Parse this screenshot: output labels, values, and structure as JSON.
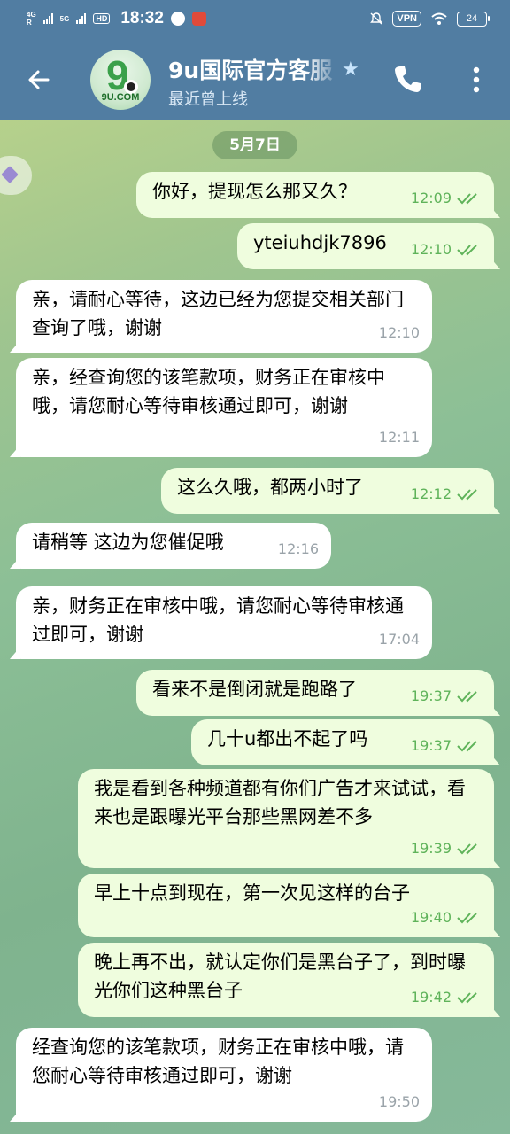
{
  "status_bar": {
    "net1": "4G",
    "net1_sub": "R",
    "net2": "5G",
    "hd": "HD",
    "time": "18:32",
    "vpn": "VPN",
    "battery": "24"
  },
  "header": {
    "title": "9u国际官方客服",
    "subtitle": "最近曾上线",
    "avatar_text": "9U.COM",
    "avatar_digit": "9"
  },
  "chat": {
    "date": "5月7日",
    "messages": [
      {
        "dir": "out",
        "text": "你好，提现怎么那又久？",
        "time": "12:09"
      },
      {
        "dir": "out",
        "text": "yteiuhdjk7896",
        "time": "12:10"
      },
      {
        "dir": "in",
        "text": "亲，请耐心等待，这边已经为您提交相关部门查询了哦，谢谢",
        "time": "12:10"
      },
      {
        "dir": "in",
        "text": "亲，经查询您的该笔款项，财务正在审核中哦，请您耐心等待审核通过即可，谢谢",
        "time": "12:11"
      },
      {
        "dir": "out",
        "text": "这么久哦，都两小时了",
        "time": "12:12"
      },
      {
        "dir": "in",
        "text": "请稍等 这边为您催促哦",
        "time": "12:16"
      },
      {
        "dir": "in",
        "text": "亲，财务正在审核中哦，请您耐心等待审核通过即可，谢谢",
        "time": "17:04"
      },
      {
        "dir": "out",
        "text": "看来不是倒闭就是跑路了",
        "time": "19:37"
      },
      {
        "dir": "out",
        "text": "几十u都出不起了吗",
        "time": "19:37"
      },
      {
        "dir": "out",
        "text": "我是看到各种频道都有你们广告才来试试，看来也是跟曝光平台那些黑网差不多",
        "time": "19:39"
      },
      {
        "dir": "out",
        "text": "早上十点到现在，第一次见这样的台子",
        "time": "19:40"
      },
      {
        "dir": "out",
        "text": "晚上再不出，就认定你们是黑台子了，到时曝光你们这种黑台子",
        "time": "19:42"
      },
      {
        "dir": "in",
        "text": "经查询您的该笔款项，财务正在审核中哦，请您耐心等待审核通过即可，谢谢",
        "time": "19:50"
      }
    ]
  },
  "colors": {
    "header_bg": "#517da2",
    "outgoing_bubble": "#effdde",
    "incoming_bubble": "#ffffff",
    "read_check": "#5fb35a"
  },
  "icons": [
    "back-arrow-icon",
    "verified-star-icon",
    "phone-icon",
    "more-vert-icon",
    "double-check-icon"
  ]
}
